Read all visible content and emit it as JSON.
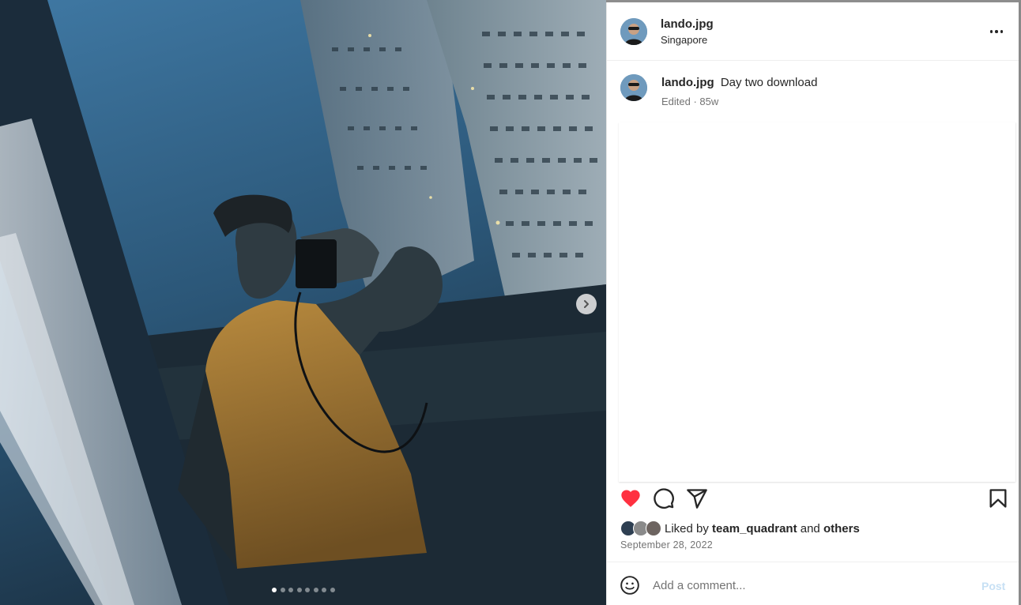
{
  "post": {
    "username": "lando.jpg",
    "location": "Singapore",
    "caption": "Day two download",
    "meta": "Edited · 85w",
    "liked_by_prefix": "Liked by",
    "liked_by_user": "team_quadrant",
    "liked_by_and": "and",
    "liked_by_others": "others",
    "date": "September 28, 2022",
    "liked": true
  },
  "carousel": {
    "total_slides": 8,
    "current_slide": 1
  },
  "comment_box": {
    "placeholder": "Add a comment...",
    "post_label": "Post"
  },
  "icons": {
    "more": "more-options-icon",
    "like": "heart-icon",
    "comment": "comment-icon",
    "share": "share-icon",
    "save": "bookmark-icon",
    "emoji": "emoji-icon",
    "next": "chevron-right-icon"
  },
  "colors": {
    "like_active": "#ff3040",
    "post_disabled": "#c7e0f4",
    "text": "#262626",
    "secondary_text": "#737373"
  }
}
